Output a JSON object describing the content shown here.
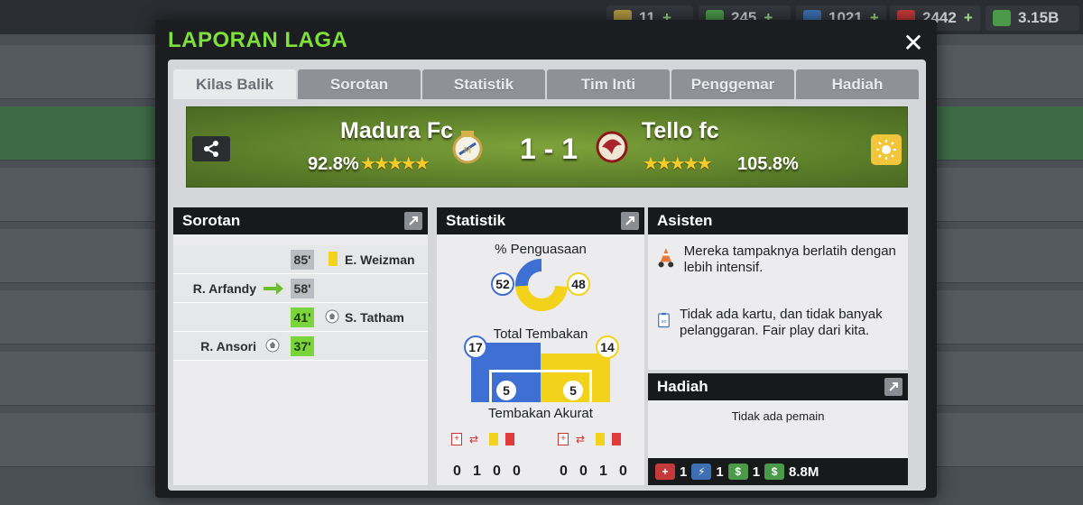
{
  "resources": {
    "item1": {
      "value": "11",
      "plus": "+"
    },
    "item2": {
      "value": "245",
      "plus": "+"
    },
    "item3": {
      "value": "1021",
      "plus": "+"
    },
    "item4": {
      "value": "2442",
      "plus": "+"
    },
    "money": {
      "value": "3.15B",
      "plus": "+"
    }
  },
  "modal": {
    "title": "LAPORAN LAGA",
    "close": "✕"
  },
  "tabs": [
    "Kilas Balik",
    "Sorotan",
    "Statistik",
    "Tim Inti",
    "Penggemar",
    "Hadiah"
  ],
  "match": {
    "home": {
      "name": "Madura Fc",
      "rating": "92.8%",
      "stars": "★★★★★"
    },
    "away": {
      "name": "Tello fc",
      "rating": "105.8%",
      "stars": "★★★★★"
    },
    "score": "1 - 1"
  },
  "highlights": {
    "title": "Sorotan",
    "events": [
      {
        "minute": "85'",
        "player": "E. Weizman",
        "type": "yellow-card",
        "side": "away"
      },
      {
        "minute": "58'",
        "player": "R. Arfandy",
        "type": "substitution",
        "side": "home"
      },
      {
        "minute": "41'",
        "player": "S. Tatham",
        "type": "goal",
        "side": "away"
      },
      {
        "minute": "37'",
        "player": "R. Ansori",
        "type": "goal",
        "side": "home"
      }
    ]
  },
  "stats": {
    "title": "Statistik",
    "possession_label": "% Penguasaan",
    "possession": {
      "home": "52",
      "away": "48"
    },
    "shots_label": "Total Tembakan",
    "shots": {
      "home": "17",
      "away": "14"
    },
    "on_target_label": "Tembakan Akurat",
    "on_target": {
      "home": "5",
      "away": "5"
    },
    "cards": {
      "home": [
        "0",
        "1",
        "0",
        "0"
      ],
      "away": [
        "0",
        "0",
        "1",
        "0"
      ]
    }
  },
  "assistant": {
    "title": "Asisten",
    "messages": [
      "Mereka tampaknya berlatih dengan lebih intensif.",
      "Tidak ada kartu, dan tidak banyak pelanggaran. Fair play dari kita."
    ]
  },
  "rewards": {
    "title": "Hadiah",
    "empty": "Tidak ada pemain",
    "items": {
      "medical": "1",
      "energy": "1",
      "cash_small": "1",
      "money": "8.8M"
    }
  },
  "colors": {
    "home": "#3e6fd2",
    "away": "#f2d21a",
    "accent": "#7ee03b",
    "goal_time": "#7ad43a"
  }
}
